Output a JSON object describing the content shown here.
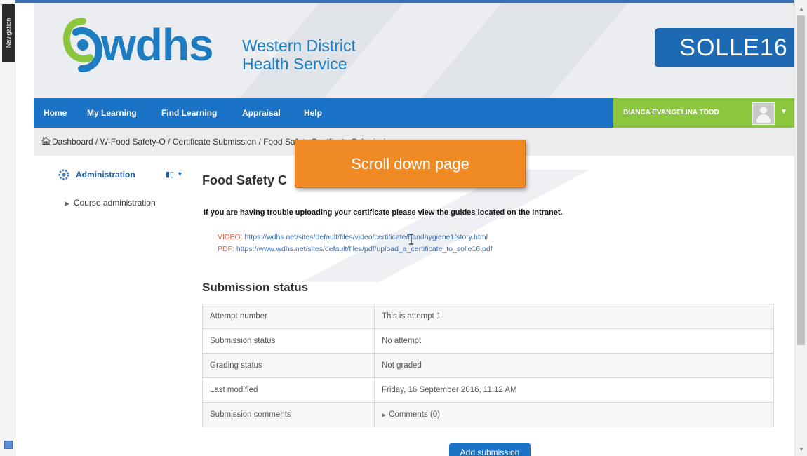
{
  "sidebar_tab": {
    "label": "Navigation"
  },
  "header": {
    "logo_text": "wdhs",
    "logo_line1": "Western District",
    "logo_line2": "Health Service",
    "site_badge": "SOLLE16"
  },
  "nav": {
    "items": [
      "Home",
      "My Learning",
      "Find Learning",
      "Appraisal",
      "Help"
    ],
    "user_name": "BIANCA EVANGELINA TODD"
  },
  "breadcrumb": {
    "text": "Dashboard / W-Food Safety-O / Certificate Submission / Food Safety Certificate Submission"
  },
  "admin_block": {
    "title": "Administration",
    "items": [
      "Course administration"
    ]
  },
  "content": {
    "heading": "Food Safety C",
    "trouble_text": "If you are having trouble uploading your certificate please view the guides located on the Intranet.",
    "video_label": "VIDEO:",
    "video_url": "https://wdhs.net/sites/default/files/video/certificate/handhygiene1/story.html",
    "pdf_label": "PDF:",
    "pdf_url": "https://www.wdhs.net/sites/default/files/pdf/upload_a_certificate_to_solle16.pdf",
    "submission_heading": "Submission status",
    "table": [
      {
        "label": "Attempt number",
        "value": "This is attempt 1."
      },
      {
        "label": "Submission status",
        "value": "No attempt"
      },
      {
        "label": "Grading status",
        "value": "Not graded"
      },
      {
        "label": "Last modified",
        "value": "Friday, 16 September 2016, 11:12 AM"
      },
      {
        "label": "Submission comments",
        "value": "Comments (0)"
      }
    ],
    "add_button": "Add submission"
  },
  "callout": {
    "text": "Scroll down page"
  },
  "colors": {
    "brand_blue": "#1a73c7",
    "user_green": "#8cc63f",
    "callout_orange": "#f08a24",
    "badge_blue": "#1d6ab3"
  },
  "icons": {
    "home": "home-icon",
    "gear": "gear-icon",
    "dock": "dock-block-icon",
    "caret": "caret-down-icon",
    "triangle": "triangle-right-icon",
    "avatar": "avatar-icon",
    "cursor": "text-cursor-icon"
  }
}
